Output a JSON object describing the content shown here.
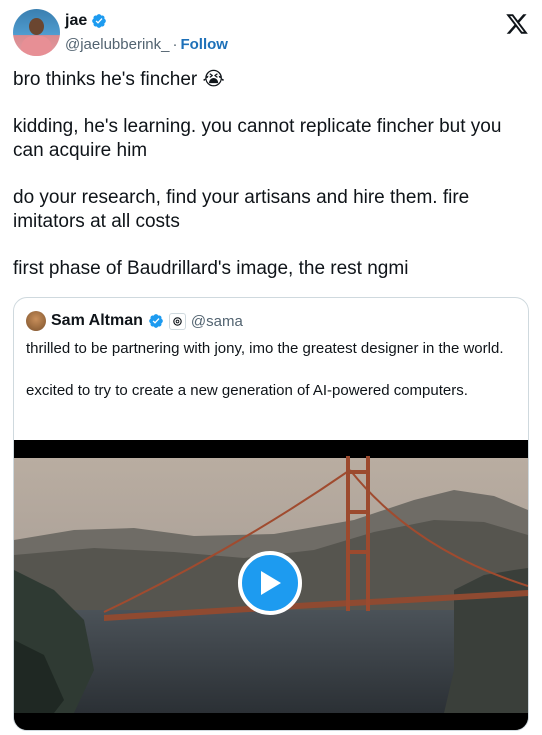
{
  "author": {
    "name": "jae",
    "handle": "@jaelubberink_",
    "separator": "·",
    "follow_label": "Follow",
    "verified": true
  },
  "tweet": {
    "paragraphs": [
      "bro thinks he's fincher",
      "kidding, he's learning. you cannot replicate fincher but you can acquire him",
      "do your research, find your artisans and hire them. fire imitators at all costs",
      "first phase of Baudrillard's image, the rest ngmi"
    ],
    "emoji": "😭"
  },
  "quote": {
    "name": "Sam Altman",
    "handle": "@sama",
    "affiliate_icon": "openai-icon",
    "paragraphs": [
      "thrilled to be partnering with jony, imo the greatest designer in the world.",
      "excited to try to create a new generation of AI-powered computers."
    ],
    "media": {
      "type": "video",
      "icon": "play-icon",
      "subject": "golden-gate-bridge"
    }
  },
  "colors": {
    "accent": "#1d9bf0",
    "follow": "#1d70b8",
    "secondary_text": "#536471"
  }
}
